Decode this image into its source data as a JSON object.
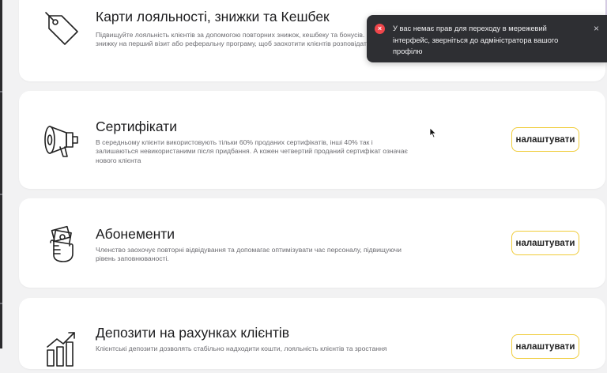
{
  "toast": {
    "message": "У вас немає прав для переходу в мережевий інтерфейс, зверніться до адміністратора вашого профілю",
    "error_glyph": "×",
    "close_glyph": "×",
    "error_color": "#f0464b"
  },
  "cards": [
    {
      "title": "Карти лояльності, знижки та Кешбек",
      "description": "Підвищуйте лояльність клієнтів за допомогою повторних знижок, кешбеку та бонусів. Запропонуйте знижку на перший візит або реферальну програму, щоб заохотити клієнтів розповідати про вас.",
      "icon": "price-tag-icon"
    },
    {
      "title": "Сертифікати",
      "description": "В середньому клієнти використовують тільки 60% проданих сертифікатів, інші 40% так і залишаються невикористаними після придбання. А кожен четвертий проданий сертифікат означає нового клієнта",
      "button": "налаштувати",
      "icon": "megaphone-icon"
    },
    {
      "title": "Абонементи",
      "description": "Членство заохочує повторні відвідування та допомагає оптимізувати час персоналу, підвищуючи рівень заповнюваності.",
      "button": "налаштувати",
      "icon": "hand-with-cash-icon"
    },
    {
      "title": "Депозити на рахунках клієнтів",
      "description": "Клієнтські депозити дозволять стабільно надходити кошти, лояльність клієнтів та зростання",
      "button": "налаштувати",
      "icon": "growth-chart-icon"
    }
  ],
  "accent_color": "#f0cc3a"
}
